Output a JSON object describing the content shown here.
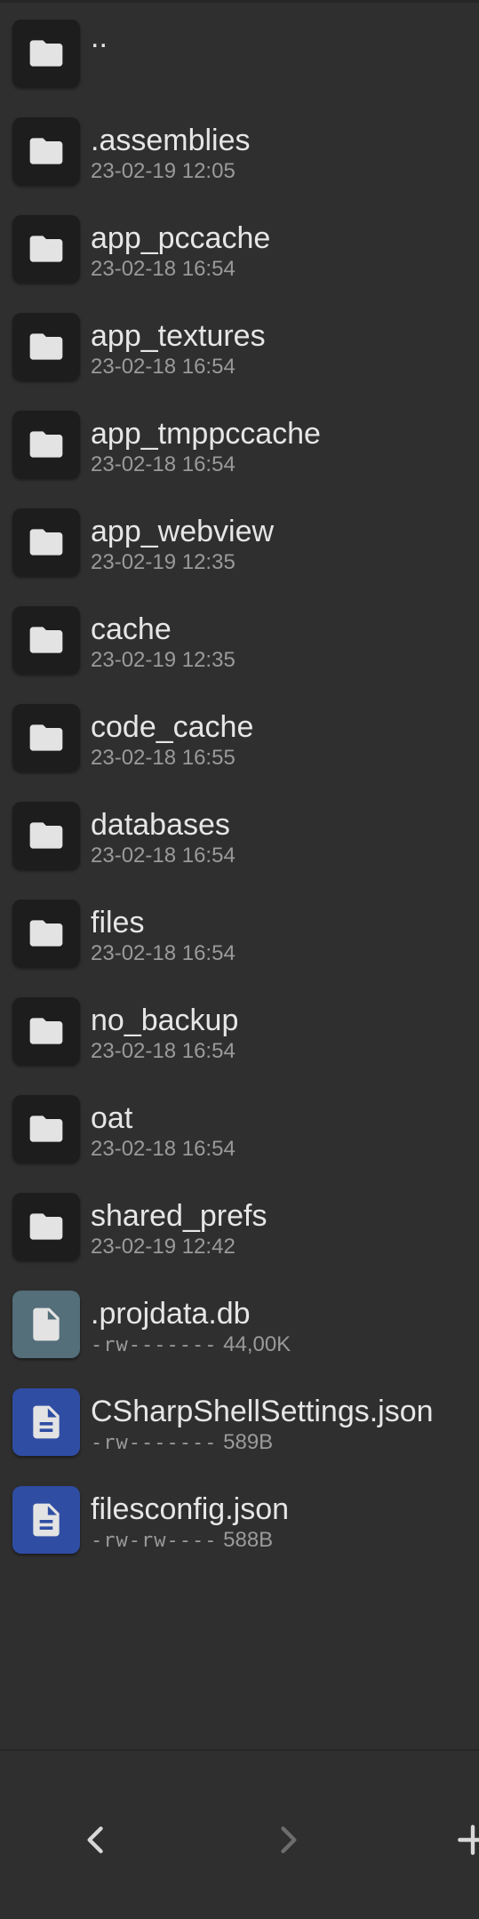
{
  "entries": [
    {
      "name": "..",
      "meta": "",
      "kind": "folder"
    },
    {
      "name": ".assemblies",
      "meta": "23-02-19 12:05",
      "kind": "folder"
    },
    {
      "name": "app_pccache",
      "meta": "23-02-18 16:54",
      "kind": "folder"
    },
    {
      "name": "app_textures",
      "meta": "23-02-18 16:54",
      "kind": "folder"
    },
    {
      "name": "app_tmppccache",
      "meta": "23-02-18 16:54",
      "kind": "folder"
    },
    {
      "name": "app_webview",
      "meta": "23-02-19 12:35",
      "kind": "folder"
    },
    {
      "name": "cache",
      "meta": "23-02-19 12:35",
      "kind": "folder"
    },
    {
      "name": "code_cache",
      "meta": "23-02-18 16:55",
      "kind": "folder"
    },
    {
      "name": "databases",
      "meta": "23-02-18 16:54",
      "kind": "folder"
    },
    {
      "name": "files",
      "meta": "23-02-18 16:54",
      "kind": "folder"
    },
    {
      "name": "no_backup",
      "meta": "23-02-18 16:54",
      "kind": "folder"
    },
    {
      "name": "oat",
      "meta": "23-02-18 16:54",
      "kind": "folder"
    },
    {
      "name": "shared_prefs",
      "meta": "23-02-19 12:42",
      "kind": "folder"
    },
    {
      "name": ".projdata.db",
      "perm": "-rw-------",
      "size": "44,00K",
      "kind": "file-generic"
    },
    {
      "name": "CSharpShellSettings.json",
      "perm": "-rw-------",
      "size": "589B",
      "kind": "file-text"
    },
    {
      "name": "filesconfig.json",
      "perm": "-rw-rw----",
      "size": "588B",
      "kind": "file-text"
    }
  ],
  "icons": {
    "folder": "folder-icon",
    "file_generic": "file-icon",
    "file_text": "text-file-icon",
    "back": "chevron-left-icon",
    "forward": "chevron-right-icon",
    "add": "plus-icon"
  },
  "colors": {
    "background": "#2f2f2f",
    "folder_tile": "#1d1d1d",
    "db_tile": "#546e7a",
    "json_tile": "#2f4da3"
  }
}
